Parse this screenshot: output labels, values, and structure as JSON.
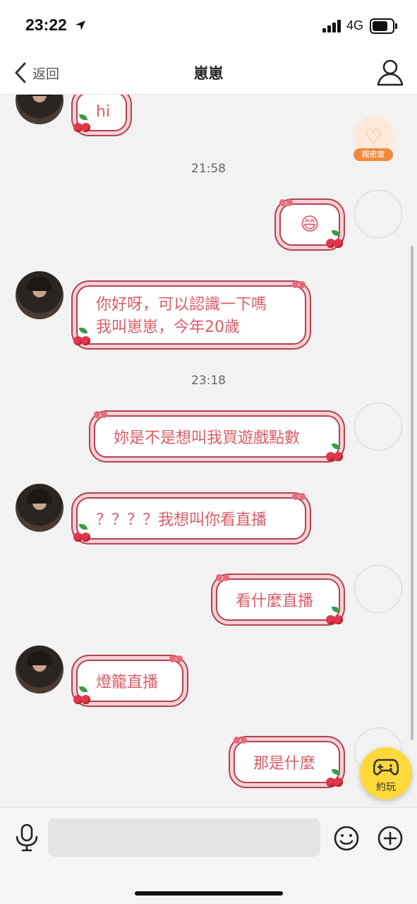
{
  "status_bar": {
    "time": "23:22",
    "network": "4G"
  },
  "nav": {
    "back_label": "返回",
    "title": "崽崽"
  },
  "intimacy": {
    "label": "親密度"
  },
  "messages": [
    {
      "from": "other",
      "text": "hi"
    },
    {
      "from": "me",
      "text": "😄"
    },
    {
      "from": "other",
      "text": "你好呀，可以認識一下嗎\n我叫崽崽，今年20歲"
    },
    {
      "from": "me",
      "text": "妳是不是想叫我買遊戲點數"
    },
    {
      "from": "other",
      "text": "？？？？我想叫你看直播"
    },
    {
      "from": "me",
      "text": "看什麼直播"
    },
    {
      "from": "other",
      "text": "燈籠直播"
    },
    {
      "from": "me",
      "text": "那是什麼"
    }
  ],
  "timestamps": [
    "21:58",
    "23:18"
  ],
  "play_button": {
    "label": "約玩"
  },
  "input": {
    "placeholder": ""
  },
  "colors": {
    "bubble_text": "#d85d69",
    "bubble_border": "#b0444f",
    "accent_yellow": "#ffd83a"
  }
}
